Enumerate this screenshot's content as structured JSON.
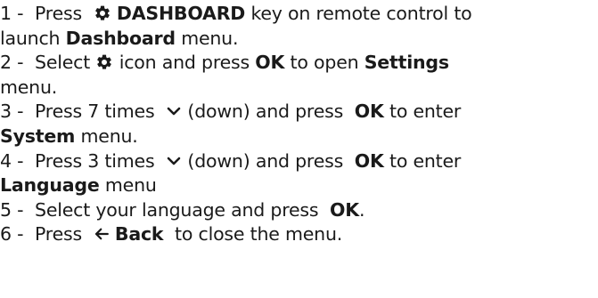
{
  "steps": [
    {
      "num": "1 -",
      "t1": "Press",
      "b1": "DASHBOARD",
      "t2": "key on remote control to",
      "t3": "launch",
      "b2": "Dashboard",
      "t4": "menu."
    },
    {
      "num": "2 -",
      "t1": "Select",
      "t2": "icon and press",
      "b1": "OK",
      "t3": "to open",
      "b2": "Settings",
      "t4": "menu."
    },
    {
      "num": "3 -",
      "t1": "Press 7 times",
      "t2": "(down) and press",
      "b1": "OK",
      "t3": "to enter",
      "b2": "System",
      "t4": "menu."
    },
    {
      "num": "4 -",
      "t1": "Press 3 times",
      "t2": "(down) and press",
      "b1": "OK",
      "t3": "to enter",
      "b2": "Language",
      "t4": "menu"
    },
    {
      "num": "5 -",
      "t1": "Select your language and press",
      "b1": "OK",
      "t2": "."
    },
    {
      "num": "6 -",
      "t1": "Press",
      "b1": "Back",
      "t2": "to close the menu."
    }
  ]
}
